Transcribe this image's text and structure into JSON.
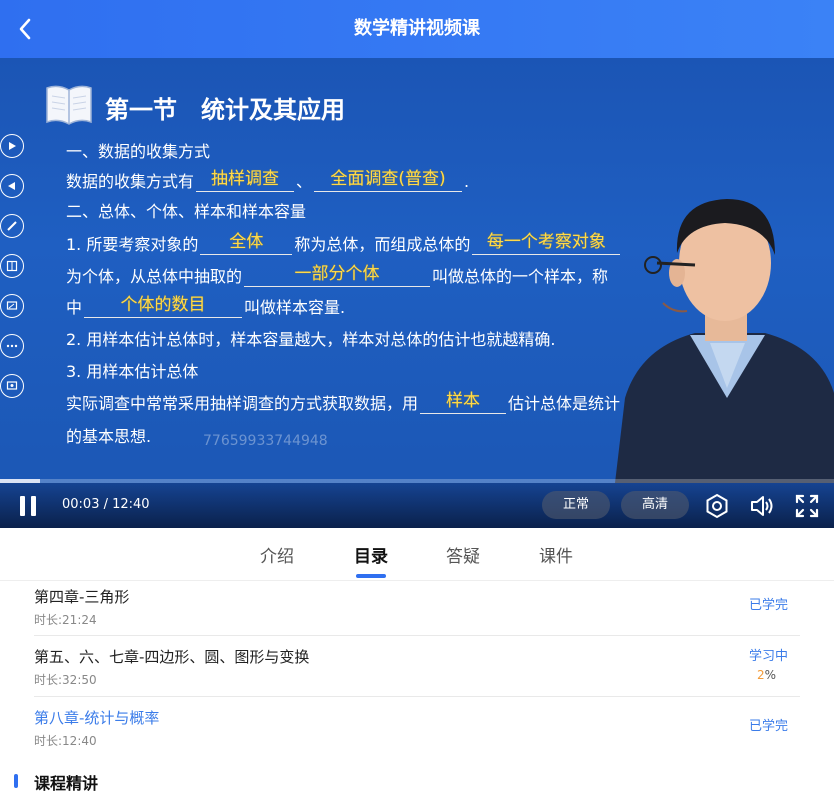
{
  "header": {
    "title": "数学精讲视频课"
  },
  "slide": {
    "title": "第一节　统计及其应用",
    "line1": "一、数据的收集方式",
    "line2_prefix": "数据的收集方式有",
    "line2_ans1": "抽样调查",
    "line2_sep": "、",
    "line2_ans2": "全面调查(普查)",
    "line2_end": ".",
    "line3": "二、总体、个体、样本和样本容量",
    "line4_prefix": "1. 所要考察对象的",
    "line4_ans1": "全体",
    "line4_mid": "称为总体，而组成总体的",
    "line4_ans2": "每一个考察对象",
    "line5_prefix": "为个体，从总体中抽取的",
    "line5_ans": "一部分个体",
    "line5_suffix": "叫做总体的一个样本，称",
    "line6_prefix": "中",
    "line6_ans": "个体的数目",
    "line6_suffix": "叫做样本容量.",
    "line7": "2. 用样本估计总体时，样本容量越大，样本对总体的估计也就越精确.",
    "line8": "3. 用样本估计总体",
    "line9_prefix": "实际调查中常常采用抽样调查的方式获取数据，用",
    "line9_ans": "样本",
    "line9_suffix": "估计总体是统计",
    "line10": "的基本思想.",
    "watermark": "77659933744948"
  },
  "player": {
    "time": "00:03 / 12:40",
    "progress_fraction": 0.005,
    "speed_label": "正常",
    "quality_label": "高清"
  },
  "tabs": [
    {
      "label": "介绍"
    },
    {
      "label": "目录"
    },
    {
      "label": "答疑"
    },
    {
      "label": "课件"
    }
  ],
  "chapters": [
    {
      "title": "第四章-三角形",
      "duration": "时长:21:24",
      "status": "已学完"
    },
    {
      "title": "第五、六、七章-四边形、圆、图形与变换",
      "duration": "时长:32:50",
      "status": "学习中",
      "percent_num": "2",
      "percent_sign": "%"
    },
    {
      "title": "第八章-统计与概率",
      "duration": "时长:12:40",
      "status": "已学完"
    }
  ],
  "section": {
    "title": "课程精讲"
  },
  "colors": {
    "brand_blue": "#2f6ff0",
    "answer_yellow": "#ffd94a",
    "status_blue": "#3b7ce9",
    "percent_orange": "#f39c3a"
  }
}
